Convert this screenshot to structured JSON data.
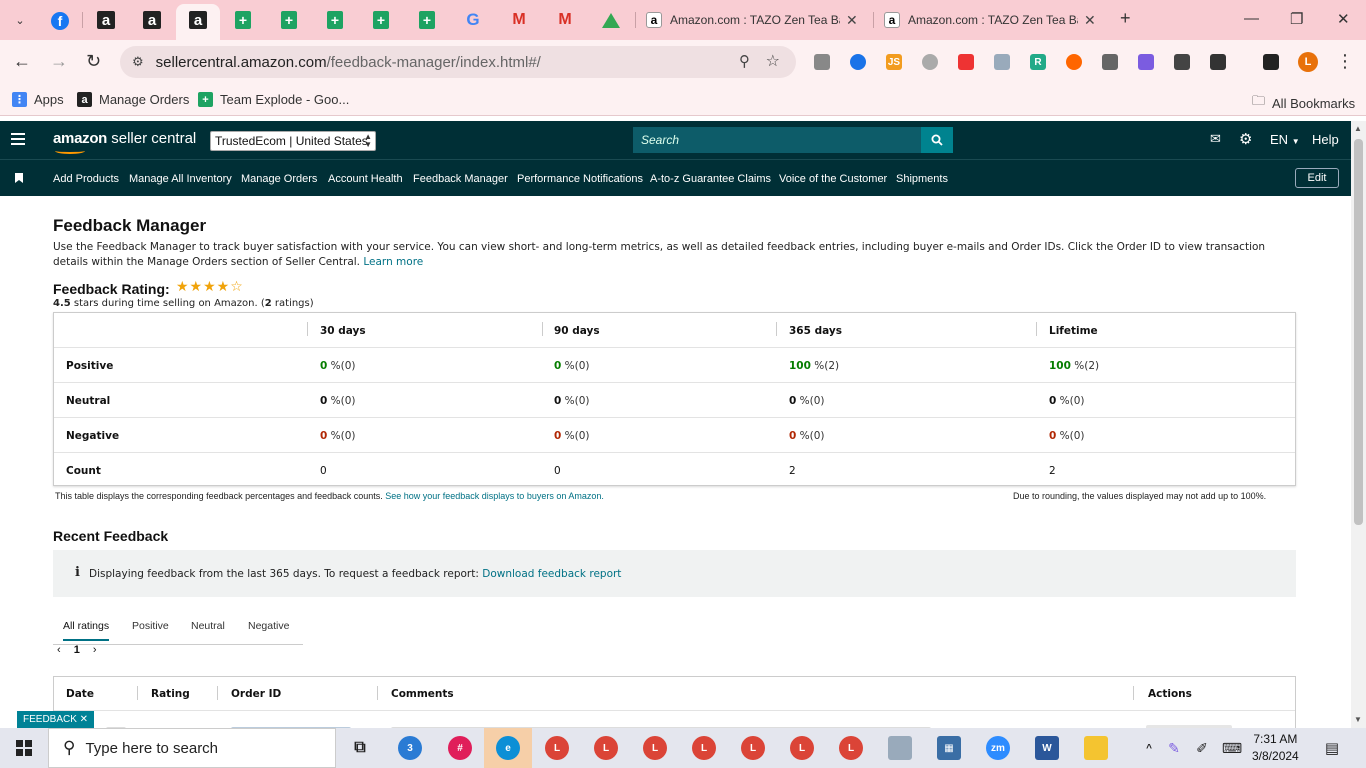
{
  "browser": {
    "tabs": [
      {
        "title": "Amazon.com : TAZO Zen Tea Ba"
      },
      {
        "title": "Amazon.com : TAZO Zen Tea Ba"
      }
    ],
    "url_host": "sellercentral.amazon.com",
    "url_path": "/feedback-manager/index.html#/",
    "profile_initial": "L",
    "bookmarks": [
      {
        "label": "Apps"
      },
      {
        "label": "Manage Orders"
      },
      {
        "label": "Team Explode - Goo..."
      }
    ],
    "all_bookmarks": "All Bookmarks"
  },
  "header": {
    "logo_bold": "amazon",
    "logo_rest": " seller central",
    "account": "TrustedEcom | United States",
    "search_placeholder": "Search",
    "language": "EN",
    "help": "Help",
    "nav": [
      "Add Products",
      "Manage All Inventory",
      "Manage Orders",
      "Account Health",
      "Feedback Manager",
      "Performance Notifications",
      "A-to-z Guarantee Claims",
      "Voice of the Customer",
      "Shipments"
    ],
    "edit": "Edit"
  },
  "page": {
    "title": "Feedback Manager",
    "intro": "Use the Feedback Manager to track buyer satisfaction with your service. You can view short- and long-term metrics, as well as detailed feedback entries, including buyer e-mails and Order IDs. Click the Order ID to view transaction details within the Manage Orders section of Seller Central.",
    "learn_more": "Learn more",
    "rating_label": "Feedback Rating:",
    "rating_stars": 4.5,
    "rating_value": "4.5",
    "rating_sub": "stars during time selling on Amazon. (",
    "rating_count": "2",
    "rating_sub_end": "ratings)",
    "table": {
      "columns": [
        "30 days",
        "90 days",
        "365 days",
        "Lifetime"
      ],
      "rows": [
        {
          "label": "Positive",
          "values": [
            {
              "n": "0",
              "c": "%(0)"
            },
            {
              "n": "0",
              "c": "%(0)"
            },
            {
              "n": "100",
              "c": "%(2)"
            },
            {
              "n": "100",
              "c": "%(2)"
            }
          ]
        },
        {
          "label": "Neutral",
          "values": [
            {
              "n": "0",
              "c": "%(0)"
            },
            {
              "n": "0",
              "c": "%(0)"
            },
            {
              "n": "0",
              "c": "%(0)"
            },
            {
              "n": "0",
              "c": "%(0)"
            }
          ]
        },
        {
          "label": "Negative",
          "values": [
            {
              "n": "0",
              "c": "%(0)"
            },
            {
              "n": "0",
              "c": "%(0)"
            },
            {
              "n": "0",
              "c": "%(0)"
            },
            {
              "n": "0",
              "c": "%(0)"
            }
          ]
        },
        {
          "label": "Count",
          "values": [
            {
              "n": "0",
              "c": ""
            },
            {
              "n": "0",
              "c": ""
            },
            {
              "n": "2",
              "c": ""
            },
            {
              "n": "2",
              "c": ""
            }
          ]
        }
      ]
    },
    "table_note": "This table displays the corresponding feedback percentages and feedback counts.",
    "table_note_link": "See how your feedback displays to buyers on Amazon.",
    "rounding_note": "Due to rounding, the values displayed may not add up to 100%.",
    "recent_title": "Recent Feedback",
    "info_text": "Displaying feedback from the last 365 days. To request a feedback report:",
    "info_link": "Download feedback report",
    "filter_tabs": [
      "All ratings",
      "Positive",
      "Neutral",
      "Negative"
    ],
    "page_number": "1",
    "recent_columns": [
      "Date",
      "Rating",
      "Order ID",
      "Comments",
      "Actions"
    ],
    "feedback_tag": "FEEDBACK ✕"
  },
  "taskbar": {
    "search_placeholder": "Type here to search",
    "time": "7:31 AM",
    "date": "3/8/2024"
  }
}
